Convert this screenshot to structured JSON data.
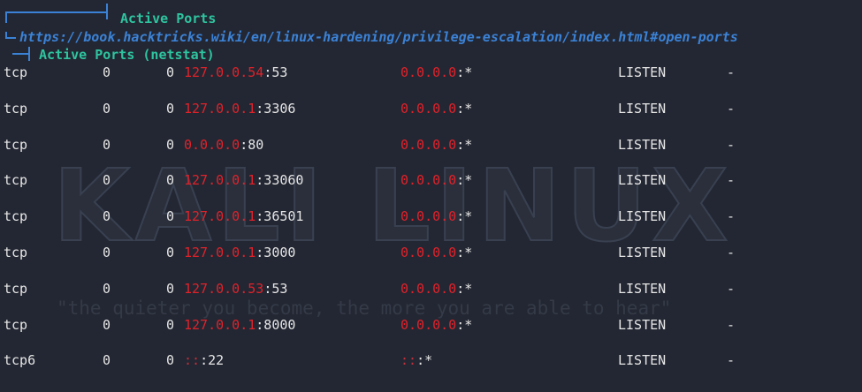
{
  "header": {
    "title": "Active Ports",
    "url": "https://book.hacktricks.wiki/en/linux-hardening/privilege-escalation/index.html#open-ports",
    "subtitle": "Active Ports (netstat)"
  },
  "watermark": {
    "logo": "KALI LINUX",
    "tagline": "\"the quieter you become, the more you are able to hear\""
  },
  "rows": [
    {
      "proto": "tcp",
      "recvq": "0",
      "sendq": "0",
      "local_ip": "127.0.0.54",
      "local_port": ":53",
      "foreign_ip": "0.0.0.0",
      "foreign_port": ":*",
      "state": "LISTEN",
      "pid": "-"
    },
    {
      "proto": "tcp",
      "recvq": "0",
      "sendq": "0",
      "local_ip": "127.0.0.1",
      "local_port": ":3306",
      "foreign_ip": "0.0.0.0",
      "foreign_port": ":*",
      "state": "LISTEN",
      "pid": "-"
    },
    {
      "proto": "tcp",
      "recvq": "0",
      "sendq": "0",
      "local_ip": "0.0.0.0",
      "local_port": ":80",
      "foreign_ip": "0.0.0.0",
      "foreign_port": ":*",
      "state": "LISTEN",
      "pid": "-"
    },
    {
      "proto": "tcp",
      "recvq": "0",
      "sendq": "0",
      "local_ip": "127.0.0.1",
      "local_port": ":33060",
      "foreign_ip": "0.0.0.0",
      "foreign_port": ":*",
      "state": "LISTEN",
      "pid": "-"
    },
    {
      "proto": "tcp",
      "recvq": "0",
      "sendq": "0",
      "local_ip": "127.0.0.1",
      "local_port": ":36501",
      "foreign_ip": "0.0.0.0",
      "foreign_port": ":*",
      "state": "LISTEN",
      "pid": "-"
    },
    {
      "proto": "tcp",
      "recvq": "0",
      "sendq": "0",
      "local_ip": "127.0.0.1",
      "local_port": ":3000",
      "foreign_ip": "0.0.0.0",
      "foreign_port": ":*",
      "state": "LISTEN",
      "pid": "-"
    },
    {
      "proto": "tcp",
      "recvq": "0",
      "sendq": "0",
      "local_ip": "127.0.0.53",
      "local_port": ":53",
      "foreign_ip": "0.0.0.0",
      "foreign_port": ":*",
      "state": "LISTEN",
      "pid": "-"
    },
    {
      "proto": "tcp",
      "recvq": "0",
      "sendq": "0",
      "local_ip": "127.0.0.1",
      "local_port": ":8000",
      "foreign_ip": "0.0.0.0",
      "foreign_port": ":*",
      "state": "LISTEN",
      "pid": "-"
    },
    {
      "proto": "tcp6",
      "recvq": "0",
      "sendq": "0",
      "local_ip": "::",
      "local_port": ":22",
      "foreign_ip": "::",
      "foreign_port": ":*",
      "state": "LISTEN",
      "pid": "-"
    }
  ],
  "colors": {
    "background": "#232733",
    "heading": "#2ec4a0",
    "link": "#3b82d6",
    "highlight": "#e0222a"
  }
}
